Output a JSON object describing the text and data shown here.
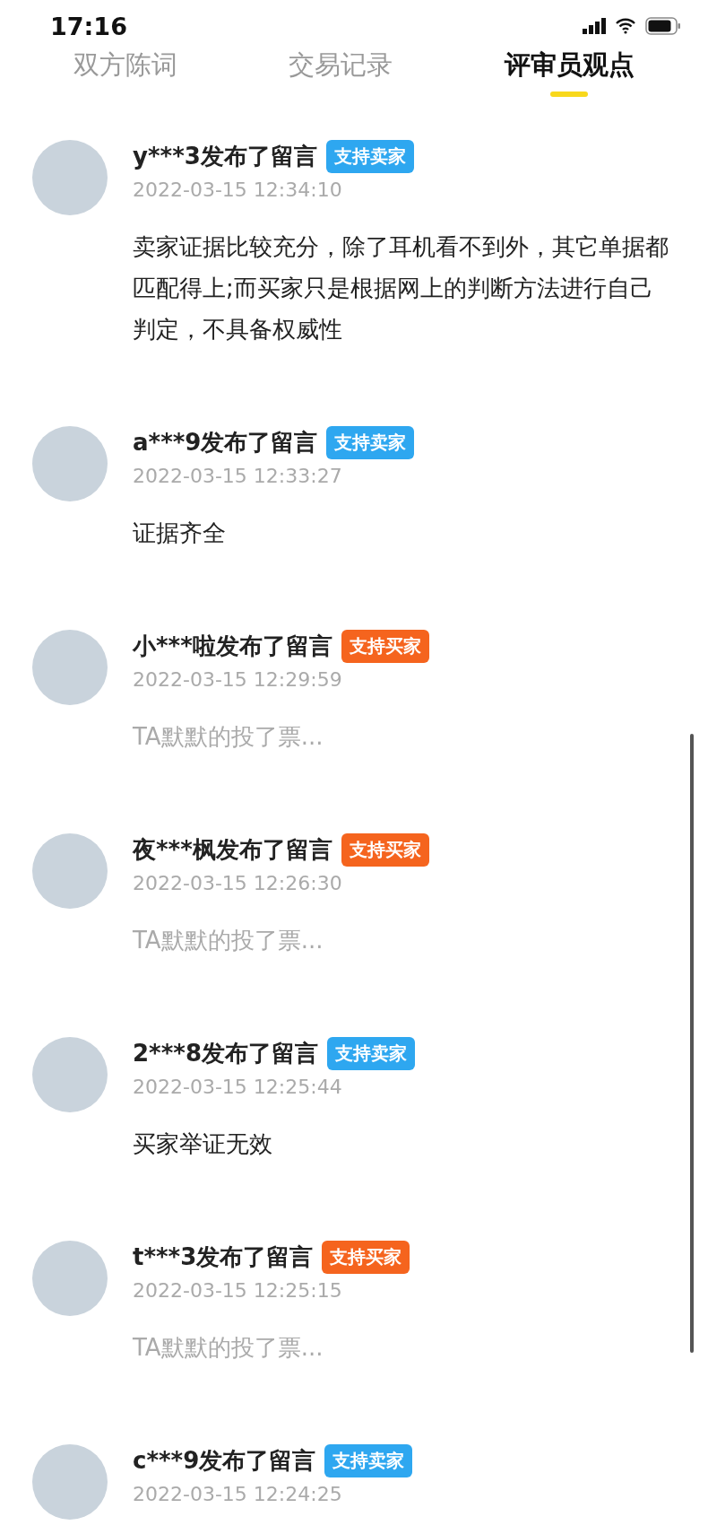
{
  "status_bar": {
    "time": "17:16"
  },
  "tabs": [
    {
      "label": "双方陈词",
      "selected": false
    },
    {
      "label": "交易记录",
      "selected": false
    },
    {
      "label": "评审员观点",
      "selected": true
    }
  ],
  "comments": [
    {
      "title": "y***3发布了留言",
      "tag": "支持卖家",
      "color": "#2ea7f0",
      "time": "2022-03-15 12:34:10",
      "kind": "text",
      "body": "卖家证据比较充分，除了耳机看不到外，其它单据都匹配得上;而买家只是根据网上的判断方法进行自己判定，不具备权威性"
    },
    {
      "title": "a***9发布了留言",
      "tag": "支持卖家",
      "color": "#2ea7f0",
      "time": "2022-03-15 12:33:27",
      "kind": "text",
      "body": "证据齐全"
    },
    {
      "title": "小***啦发布了留言",
      "tag": "支持买家",
      "color": "#f5641e",
      "time": "2022-03-15 12:29:59",
      "kind": "vote",
      "body": "TA默默的投了票..."
    },
    {
      "title": "夜***枫发布了留言",
      "tag": "支持买家",
      "color": "#f5641e",
      "time": "2022-03-15 12:26:30",
      "kind": "vote",
      "body": "TA默默的投了票..."
    },
    {
      "title": "2***8发布了留言",
      "tag": "支持卖家",
      "color": "#2ea7f0",
      "time": "2022-03-15 12:25:44",
      "kind": "text",
      "body": "买家举证无效"
    },
    {
      "title": "t***3发布了留言",
      "tag": "支持买家",
      "color": "#f5641e",
      "time": "2022-03-15 12:25:15",
      "kind": "vote",
      "body": "TA默默的投了票..."
    },
    {
      "title": "c***9发布了留言",
      "tag": "支持卖家",
      "color": "#2ea7f0",
      "time": "2022-03-15 12:24:25"
    }
  ]
}
